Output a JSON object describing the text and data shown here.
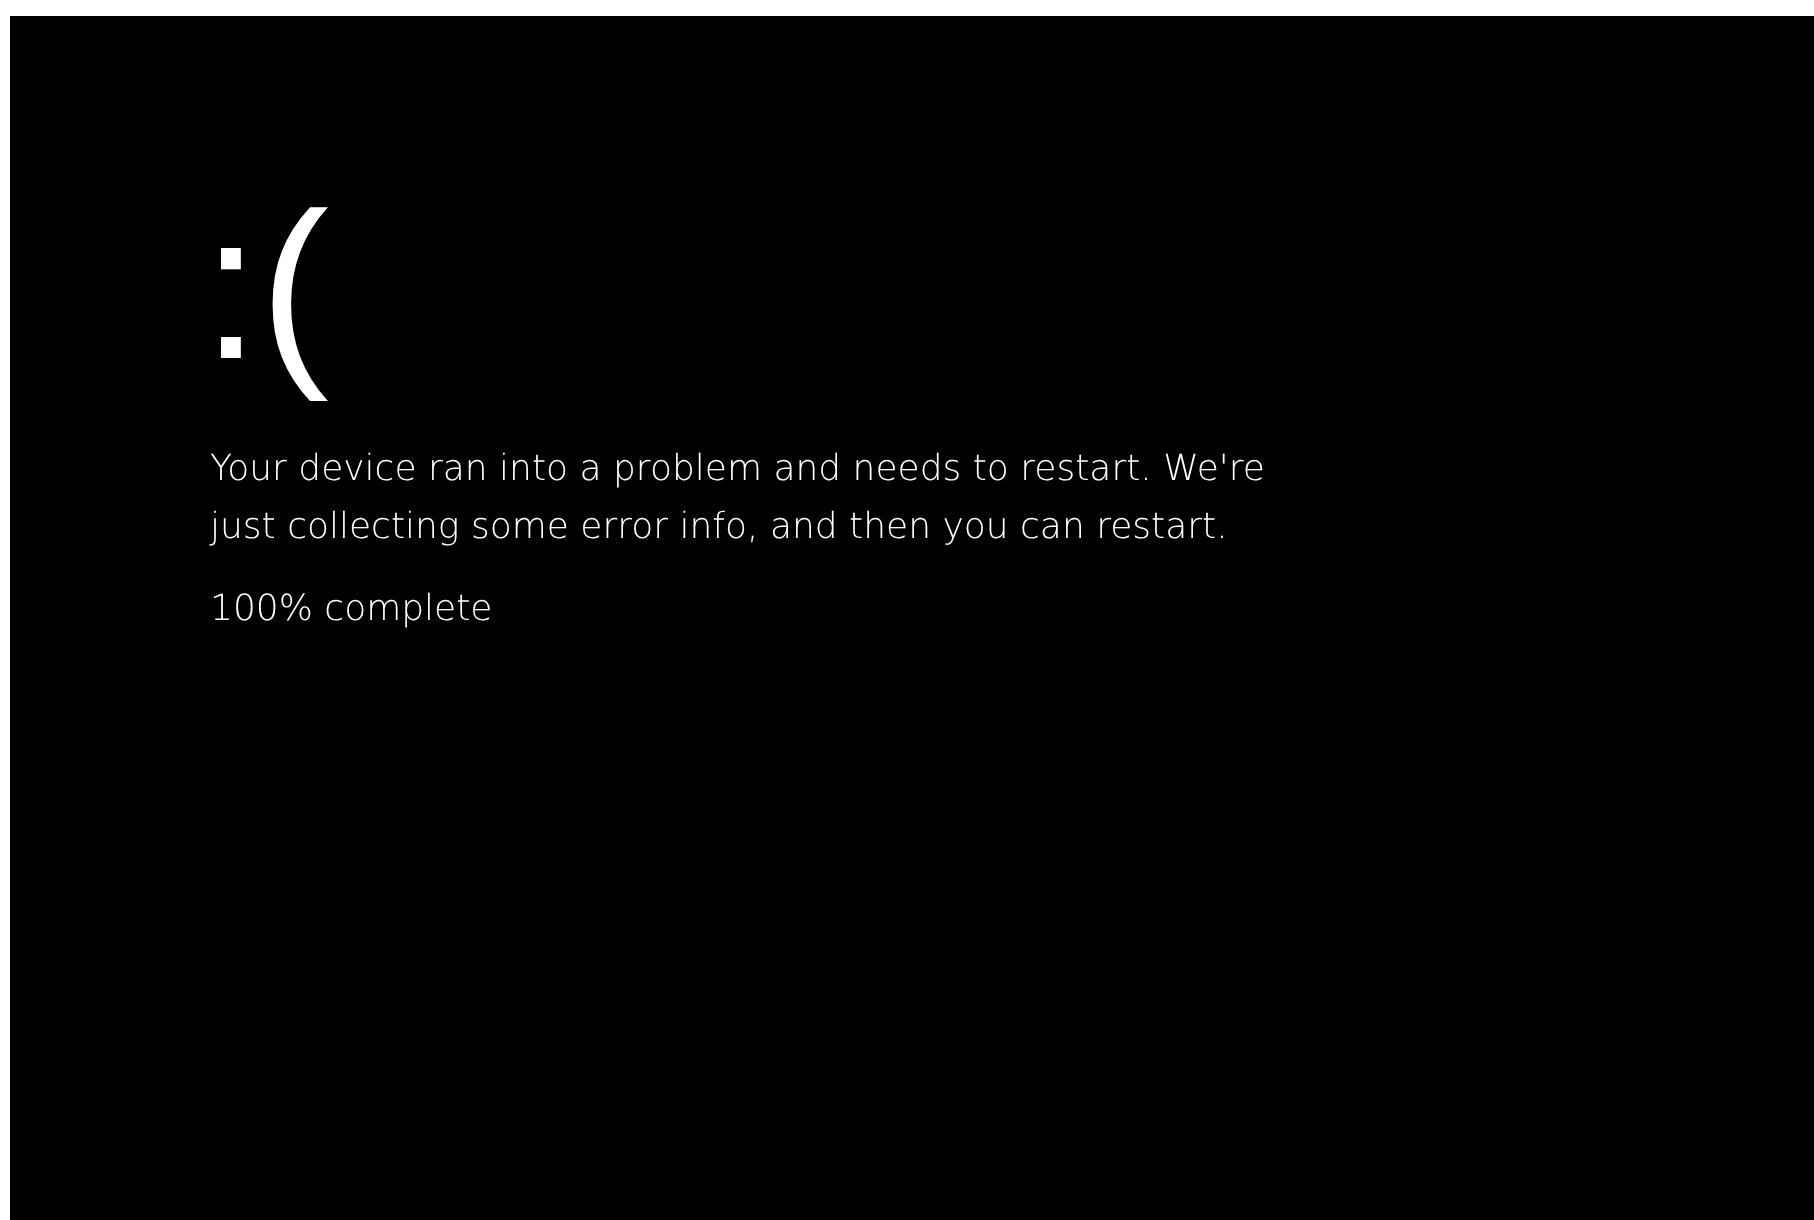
{
  "face": ":(",
  "message": "Your device ran into a problem and needs to restart. We're just collecting some error info, and then you can restart.",
  "progress": "100% complete"
}
